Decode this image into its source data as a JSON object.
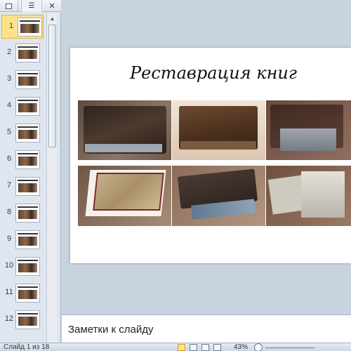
{
  "thumbnails_pane": {
    "tabs": [
      {
        "icon": "slides-tab-icon"
      },
      {
        "icon": "outline-tab-icon"
      },
      {
        "icon": "close-icon",
        "label": "✕"
      }
    ],
    "slides": [
      {
        "number": "1",
        "selected": true
      },
      {
        "number": "2",
        "selected": false
      },
      {
        "number": "3",
        "selected": false
      },
      {
        "number": "4",
        "selected": false
      },
      {
        "number": "5",
        "selected": false
      },
      {
        "number": "6",
        "selected": false
      },
      {
        "number": "7",
        "selected": false
      },
      {
        "number": "8",
        "selected": false
      },
      {
        "number": "9",
        "selected": false
      },
      {
        "number": "10",
        "selected": false
      },
      {
        "number": "11",
        "selected": false
      },
      {
        "number": "12",
        "selected": false
      }
    ],
    "scroll_up_glyph": "▲"
  },
  "slide": {
    "title": "Реставрация книг",
    "photos": [
      {
        "name": "old-book-photo-1",
        "bg": "#6d5a4a",
        "book": "#3e2d22"
      },
      {
        "name": "old-book-photo-2",
        "bg": "#e8d6c2",
        "book": "#5b3a24"
      },
      {
        "name": "old-book-photo-3",
        "bg": "#7a5b4c",
        "book": "#8d9298"
      },
      {
        "name": "old-book-photo-4",
        "bg": "#8a6e5a",
        "book": "#c7b48e"
      },
      {
        "name": "old-book-photo-5",
        "bg": "#9a7c68",
        "book": "#4a3a32"
      },
      {
        "name": "old-book-photo-6",
        "bg": "#7d5f4c",
        "book": "#c9c5bb"
      }
    ]
  },
  "notes": {
    "placeholder": "Заметки к слайду"
  },
  "statusbar": {
    "slide_info": "Слайд 1 из 18",
    "zoom": "43%"
  },
  "colors": {
    "selection": "#fde28a",
    "workspace": "#c9d3df"
  }
}
